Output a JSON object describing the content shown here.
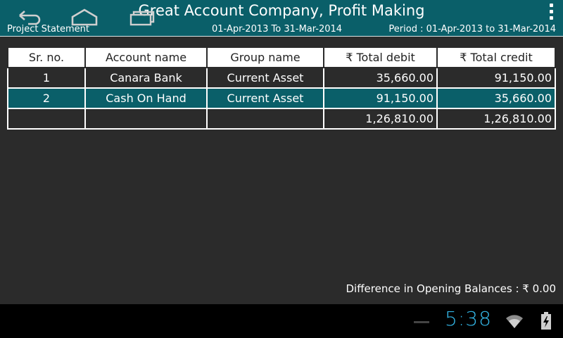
{
  "header": {
    "title": "Great Account Company, Profit Making",
    "report_name": "Project Statement",
    "date_range": "01-Apr-2013 To 31-Mar-2014",
    "period": "Period : 01-Apr-2013 to 31-Mar-2014"
  },
  "table": {
    "columns": [
      "Sr. no.",
      "Account name",
      "Group name",
      "₹ Total debit",
      "₹ Total credit"
    ],
    "rows": [
      {
        "sr": "1",
        "account": "Canara Bank",
        "group": "Current Asset",
        "debit": "35,660.00",
        "credit": "91,150.00",
        "selected": false
      },
      {
        "sr": "2",
        "account": "Cash On Hand",
        "group": "Current Asset",
        "debit": "91,150.00",
        "credit": "35,660.00",
        "selected": true
      }
    ],
    "totals": {
      "sr": "",
      "account": "",
      "group": "",
      "debit": "1,26,810.00",
      "credit": "1,26,810.00"
    }
  },
  "footer": {
    "difference": "Difference in Opening Balances : ₹ 0.00"
  },
  "system_bar": {
    "time": "5:38",
    "icons": [
      "back-icon",
      "home-icon",
      "recent-apps-icon",
      "wifi-icon",
      "battery-charging-icon"
    ],
    "accent_color": "#33b5e5"
  },
  "colors": {
    "header_bg": "#0a5f69",
    "body_bg": "#2b2b2b",
    "selected_row": "#0a5f69"
  }
}
